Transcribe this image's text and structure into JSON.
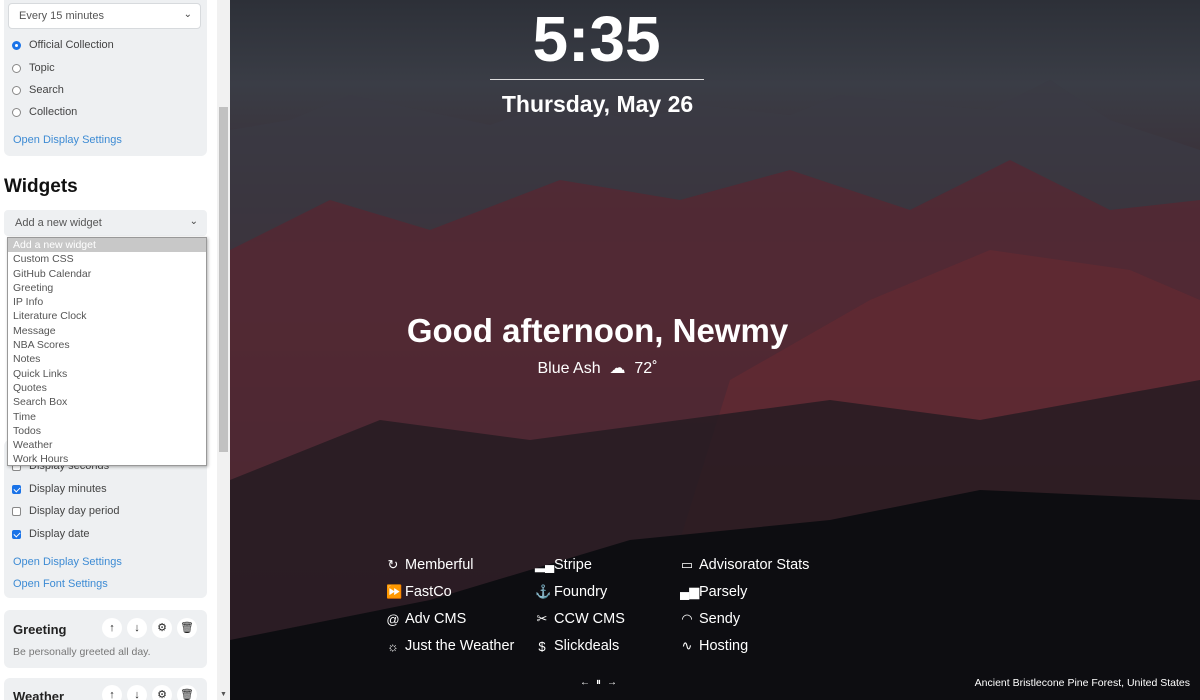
{
  "sidebar": {
    "frequency": "Every 15 minutes",
    "sources": [
      {
        "label": "Official Collection",
        "checked": true
      },
      {
        "label": "Topic",
        "checked": false
      },
      {
        "label": "Search",
        "checked": false
      },
      {
        "label": "Collection",
        "checked": false
      }
    ],
    "open_display_settings": "Open Display Settings",
    "widgets_heading": "Widgets",
    "add_widget_placeholder": "Add a new widget",
    "dropdown_options": [
      "Add a new widget",
      "Custom CSS",
      "GitHub Calendar",
      "Greeting",
      "IP Info",
      "Literature Clock",
      "Message",
      "NBA Scores",
      "Notes",
      "Quick Links",
      "Quotes",
      "Search Box",
      "Time",
      "Todos",
      "Weather",
      "Work Hours"
    ],
    "time_options": [
      {
        "label": "Display seconds",
        "checked": false
      },
      {
        "label": "Display minutes",
        "checked": true
      },
      {
        "label": "Display day period",
        "checked": false
      },
      {
        "label": "Display date",
        "checked": true
      }
    ],
    "open_display_settings_2": "Open Display Settings",
    "open_font_settings": "Open Font Settings",
    "greeting": {
      "title": "Greeting",
      "desc": "Be personally greeted all day."
    },
    "weather": {
      "title": "Weather"
    },
    "icons": {
      "up": "↑",
      "down": "↓",
      "settings": "⚙",
      "delete": "🗑"
    }
  },
  "main": {
    "time": "5:35",
    "date": "Thursday, May 26",
    "greeting": "Good afternoon, Newmy",
    "location": "Blue Ash",
    "weather_icon": "cloud-lightning-icon",
    "temperature": "72˚",
    "links": [
      {
        "icon": "↻",
        "label": "Memberful"
      },
      {
        "icon": "⏩",
        "label": "FastCo"
      },
      {
        "icon": "@",
        "label": "Adv CMS"
      },
      {
        "icon": "☼",
        "label": "Just the Weather"
      },
      {
        "icon": "▂▄",
        "label": "Stripe"
      },
      {
        "icon": "⚓",
        "label": "Foundry"
      },
      {
        "icon": "✂",
        "label": "CCW CMS"
      },
      {
        "icon": "$",
        "label": "Slickdeals"
      },
      {
        "icon": "▭",
        "label": "Advisorator Stats"
      },
      {
        "icon": "▄▆",
        "label": "Parsely"
      },
      {
        "icon": "◠",
        "label": "Sendy"
      },
      {
        "icon": "∿",
        "label": "Hosting"
      }
    ],
    "nav": {
      "prev": "←",
      "pause": "⏸",
      "next": "→"
    },
    "photo_credit": "Ancient Bristlecone Pine Forest, United States"
  }
}
